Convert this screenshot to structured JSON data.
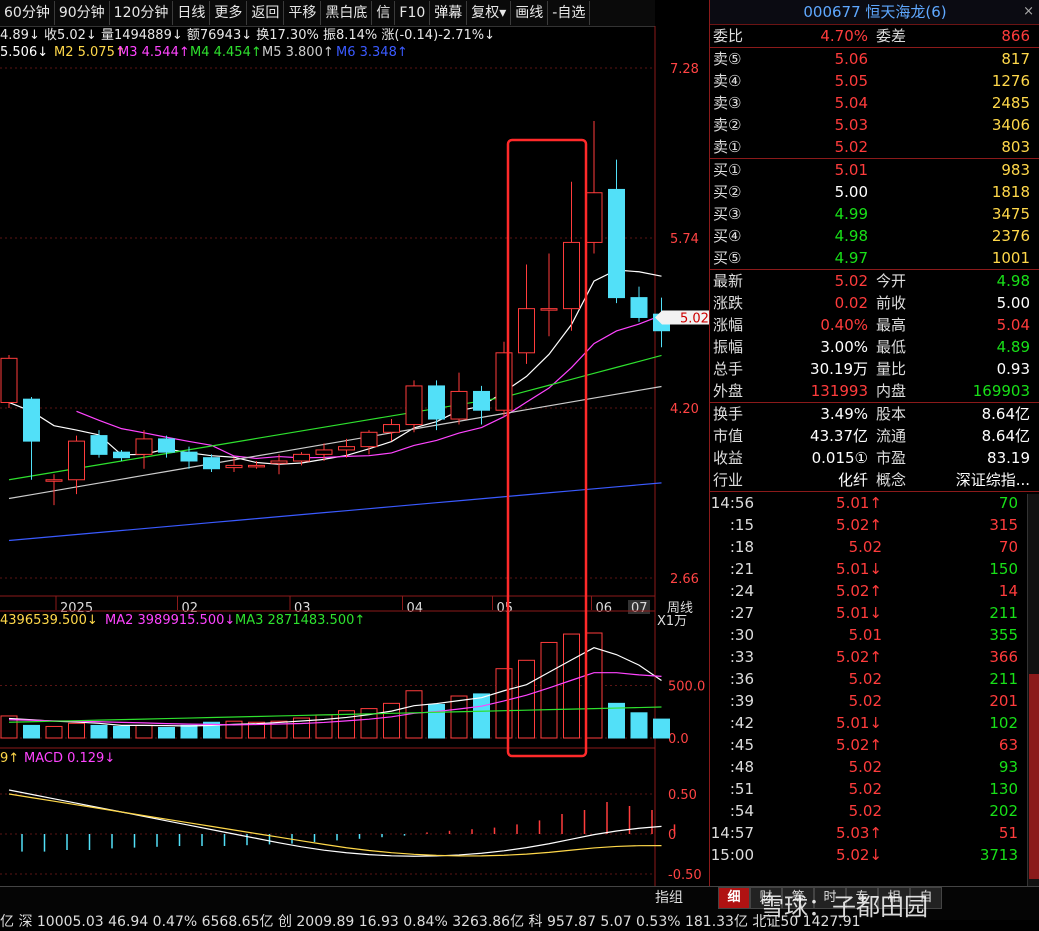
{
  "toolbar": [
    "60分钟",
    "90分钟",
    "120分钟",
    "日线",
    "更多",
    "返回",
    "平移",
    "黑白底",
    "信",
    "F10",
    "弹幕",
    "复权▾",
    "画线",
    "-自选"
  ],
  "info": {
    "line1": "4.89↓ 收5.02↓ 量1494889↓ 额76943↓ 换17.30% 振8.14% 涨(-0.14)-2.71%↓",
    "line2_ma1": "5.506↓",
    "line2_ma2": "M2 5.075↑",
    "line2_ma3": "M3 4.544↑",
    "line2_ma4": "M4 4.454↑",
    "line2_ma5": "M5 3.800↑",
    "line2_ma6": "M6 3.348↑"
  },
  "price_axis": [
    "7.28",
    "5.74",
    "4.20",
    "2.66"
  ],
  "current_price_label": "5.02",
  "date_axis": [
    "2025",
    "02",
    "03",
    "04",
    "05",
    "06",
    "07"
  ],
  "period_label": "周线",
  "volume": {
    "legend_ma1": "4396539.500↓",
    "legend_ma2": "MA2 3989915.500↓",
    "legend_ma3": "MA3 2871483.500↑",
    "unit": "X1万",
    "axis": [
      "500.0",
      "0.0"
    ]
  },
  "macd": {
    "legend_a": "9↑",
    "legend_b": "MACD 0.129↓",
    "axis": [
      "0.50",
      "0",
      "-0.50"
    ]
  },
  "zhizu": "指组",
  "chart_data": {
    "type": "candlestick",
    "candles": [
      {
        "o": 4.25,
        "c": 4.65,
        "h": 4.68,
        "l": 4.2
      },
      {
        "o": 4.28,
        "c": 3.9,
        "h": 4.3,
        "l": 3.55
      },
      {
        "o": 3.55,
        "c": 3.55,
        "h": 3.6,
        "l": 3.32
      },
      {
        "o": 3.55,
        "c": 3.9,
        "h": 3.95,
        "l": 3.42
      },
      {
        "o": 3.95,
        "c": 3.78,
        "h": 4.0,
        "l": 3.75
      },
      {
        "o": 3.8,
        "c": 3.75,
        "h": 3.82,
        "l": 3.72
      },
      {
        "o": 3.78,
        "c": 3.92,
        "h": 4.0,
        "l": 3.65
      },
      {
        "o": 3.92,
        "c": 3.8,
        "h": 3.95,
        "l": 3.75
      },
      {
        "o": 3.8,
        "c": 3.72,
        "h": 3.85,
        "l": 3.65
      },
      {
        "o": 3.75,
        "c": 3.65,
        "h": 3.78,
        "l": 3.62
      },
      {
        "o": 3.66,
        "c": 3.68,
        "h": 3.75,
        "l": 3.62
      },
      {
        "o": 3.68,
        "c": 3.68,
        "h": 3.72,
        "l": 3.65
      },
      {
        "o": 3.7,
        "c": 3.72,
        "h": 3.78,
        "l": 3.6
      },
      {
        "o": 3.72,
        "c": 3.78,
        "h": 3.8,
        "l": 3.68
      },
      {
        "o": 3.78,
        "c": 3.82,
        "h": 3.88,
        "l": 3.72
      },
      {
        "o": 3.82,
        "c": 3.85,
        "h": 3.92,
        "l": 3.75
      },
      {
        "o": 3.85,
        "c": 3.98,
        "h": 4.0,
        "l": 3.78
      },
      {
        "o": 3.98,
        "c": 4.05,
        "h": 4.1,
        "l": 3.9
      },
      {
        "o": 4.05,
        "c": 4.4,
        "h": 4.45,
        "l": 3.98
      },
      {
        "o": 4.4,
        "c": 4.1,
        "h": 4.45,
        "l": 4.0
      },
      {
        "o": 4.1,
        "c": 4.35,
        "h": 4.52,
        "l": 4.05
      },
      {
        "o": 4.35,
        "c": 4.18,
        "h": 4.4,
        "l": 4.05
      },
      {
        "o": 4.18,
        "c": 4.7,
        "h": 4.8,
        "l": 4.12
      },
      {
        "o": 4.7,
        "c": 5.1,
        "h": 5.5,
        "l": 4.6
      },
      {
        "o": 5.1,
        "c": 5.1,
        "h": 5.6,
        "l": 4.85
      },
      {
        "o": 5.1,
        "c": 5.7,
        "h": 6.25,
        "l": 4.9
      },
      {
        "o": 5.7,
        "c": 6.15,
        "h": 6.8,
        "l": 5.6
      },
      {
        "o": 6.18,
        "c": 5.2,
        "h": 6.45,
        "l": 5.15
      },
      {
        "o": 5.2,
        "c": 5.02,
        "h": 5.3,
        "l": 4.98
      },
      {
        "o": 5.05,
        "c": 4.9,
        "h": 5.2,
        "l": 4.75
      }
    ],
    "ylim": [
      2.66,
      7.28
    ],
    "volume_values": [
      210,
      120,
      110,
      140,
      120,
      110,
      120,
      100,
      120,
      150,
      160,
      150,
      160,
      190,
      220,
      260,
      280,
      330,
      450,
      320,
      400,
      420,
      660,
      740,
      910,
      990,
      1000,
      330,
      240,
      180
    ],
    "volume_ylim": [
      0,
      1000
    ],
    "macd_hist": [
      -0.22,
      -0.22,
      -0.2,
      -0.2,
      -0.18,
      -0.17,
      -0.16,
      -0.15,
      -0.15,
      -0.15,
      -0.14,
      -0.13,
      -0.12,
      -0.1,
      -0.08,
      -0.06,
      -0.04,
      -0.02,
      0.02,
      0.04,
      0.06,
      0.08,
      0.12,
      0.17,
      0.25,
      0.3,
      0.4,
      0.35,
      0.3,
      0.12
    ],
    "macd_ylim": [
      -0.5,
      0.8
    ]
  },
  "quote": {
    "title": "000677 恒天海龙(6)",
    "close": "×",
    "weibi_label": "委比",
    "weibi": "4.70%",
    "weicha_label": "委差",
    "weicha": "866",
    "sell": [
      {
        "label": "卖⑤",
        "price": "5.06",
        "vol": "817"
      },
      {
        "label": "卖④",
        "price": "5.05",
        "vol": "1276"
      },
      {
        "label": "卖③",
        "price": "5.04",
        "vol": "2485"
      },
      {
        "label": "卖②",
        "price": "5.03",
        "vol": "3406"
      },
      {
        "label": "卖①",
        "price": "5.02",
        "vol": "803"
      }
    ],
    "buy": [
      {
        "label": "买①",
        "price": "5.01",
        "vol": "983",
        "pc": "red"
      },
      {
        "label": "买②",
        "price": "5.00",
        "vol": "1818",
        "pc": "white"
      },
      {
        "label": "买③",
        "price": "4.99",
        "vol": "3475",
        "pc": "green"
      },
      {
        "label": "买④",
        "price": "4.98",
        "vol": "2376",
        "pc": "green"
      },
      {
        "label": "买⑤",
        "price": "4.97",
        "vol": "1001",
        "pc": "green"
      }
    ],
    "stats": [
      {
        "l1": "最新",
        "v1": "5.02",
        "c1": "red",
        "l2": "今开",
        "v2": "4.98",
        "c2": "green"
      },
      {
        "l1": "涨跌",
        "v1": "0.02",
        "c1": "red",
        "l2": "前收",
        "v2": "5.00",
        "c2": "white"
      },
      {
        "l1": "涨幅",
        "v1": "0.40%",
        "c1": "red",
        "l2": "最高",
        "v2": "5.04",
        "c2": "red"
      },
      {
        "l1": "振幅",
        "v1": "3.00%",
        "c1": "white",
        "l2": "最低",
        "v2": "4.89",
        "c2": "green"
      },
      {
        "l1": "总手",
        "v1": "30.19万",
        "c1": "white",
        "l2": "量比",
        "v2": "0.93",
        "c2": "white"
      },
      {
        "l1": "外盘",
        "v1": "131993",
        "c1": "red",
        "l2": "内盘",
        "v2": "169903",
        "c2": "green"
      }
    ],
    "fund": [
      {
        "l1": "换手",
        "v1": "3.49%",
        "l2": "股本",
        "v2": "8.64亿"
      },
      {
        "l1": "市值",
        "v1": "43.37亿",
        "l2": "流通",
        "v2": "8.64亿"
      },
      {
        "l1": "收益",
        "v1": "0.015①",
        "l2": "市盈",
        "v2": "83.19"
      },
      {
        "l1": "行业",
        "v1": "化纤",
        "l2": "概念",
        "v2": "深证综指..."
      }
    ]
  },
  "ticks": [
    {
      "t": "14:56",
      "p": "5.01↑",
      "pc": "red",
      "v": "70",
      "vc": "green"
    },
    {
      "t": ":15",
      "p": "5.02↑",
      "pc": "red",
      "v": "315",
      "vc": "red"
    },
    {
      "t": ":18",
      "p": "5.02",
      "pc": "red",
      "v": "70",
      "vc": "red"
    },
    {
      "t": ":21",
      "p": "5.01↓",
      "pc": "red",
      "v": "150",
      "vc": "green"
    },
    {
      "t": ":24",
      "p": "5.02↑",
      "pc": "red",
      "v": "14",
      "vc": "red"
    },
    {
      "t": ":27",
      "p": "5.01↓",
      "pc": "red",
      "v": "211",
      "vc": "green"
    },
    {
      "t": ":30",
      "p": "5.01",
      "pc": "red",
      "v": "355",
      "vc": "green"
    },
    {
      "t": ":33",
      "p": "5.02↑",
      "pc": "red",
      "v": "366",
      "vc": "red"
    },
    {
      "t": ":36",
      "p": "5.02",
      "pc": "red",
      "v": "211",
      "vc": "green"
    },
    {
      "t": ":39",
      "p": "5.02",
      "pc": "red",
      "v": "201",
      "vc": "red"
    },
    {
      "t": ":42",
      "p": "5.01↓",
      "pc": "red",
      "v": "102",
      "vc": "green"
    },
    {
      "t": ":45",
      "p": "5.02↑",
      "pc": "red",
      "v": "63",
      "vc": "red"
    },
    {
      "t": ":48",
      "p": "5.02",
      "pc": "red",
      "v": "93",
      "vc": "green"
    },
    {
      "t": ":51",
      "p": "5.02",
      "pc": "red",
      "v": "130",
      "vc": "green"
    },
    {
      "t": ":54",
      "p": "5.02",
      "pc": "red",
      "v": "202",
      "vc": "green"
    },
    {
      "t": "14:57",
      "p": "5.03↑",
      "pc": "red",
      "v": "51",
      "vc": "red"
    },
    {
      "t": "15:00",
      "p": "5.02↓",
      "pc": "red",
      "v": "3713",
      "vc": "green"
    }
  ],
  "bottom": {
    "ticker": "亿 深 10005.03 46.94 0.47% 6568.65亿 创 2009.89 16.93 0.84% 3263.86亿 科 957.87 5.07 0.53% 181.33亿 北证50 1427.91",
    "tabs": [
      "细",
      "财",
      "筹",
      "时",
      "专",
      "相",
      "自"
    ],
    "watermark": "雪球：子都田园"
  },
  "colors": {
    "up": "#ff3c3c",
    "down": "#52e0f8",
    "highlight_box": "#ff2a2a"
  }
}
